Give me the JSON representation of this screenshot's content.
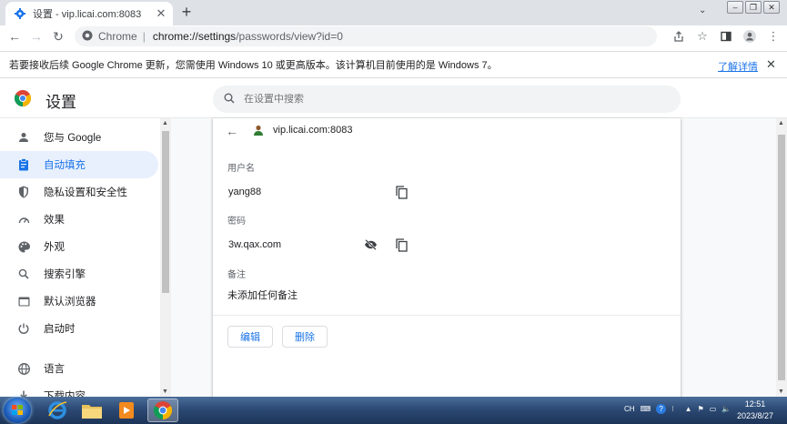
{
  "browser": {
    "tab_title": "设置 - vip.licai.com:8083",
    "new_tab_symbol": "+",
    "site_label": "Chrome",
    "url_scheme": "chrome://",
    "url_host": "settings",
    "url_path": "/passwords/view?id=0"
  },
  "infobar": {
    "message": "若要接收后续 Google Chrome 更新，您需使用 Windows 10 或更高版本。该计算机目前使用的是 Windows 7。",
    "learn_more": "了解详情"
  },
  "settings": {
    "title": "设置",
    "search_placeholder": "在设置中搜索"
  },
  "sidebar": {
    "items": [
      {
        "label": "您与 Google",
        "icon": "person-icon"
      },
      {
        "label": "自动填充",
        "icon": "clipboard-icon",
        "active": true
      },
      {
        "label": "隐私设置和安全性",
        "icon": "shield-icon"
      },
      {
        "label": "效果",
        "icon": "speedometer-icon"
      },
      {
        "label": "外观",
        "icon": "palette-icon"
      },
      {
        "label": "搜索引擎",
        "icon": "search-icon"
      },
      {
        "label": "默认浏览器",
        "icon": "browser-icon"
      },
      {
        "label": "启动时",
        "icon": "power-icon"
      },
      {
        "label": "语言",
        "icon": "globe-icon"
      },
      {
        "label": "下载内容",
        "icon": "download-icon"
      }
    ]
  },
  "password_view": {
    "site": "vip.licai.com:8083",
    "username_label": "用户名",
    "username": "yang88",
    "password_label": "密码",
    "password": "3w.qax.com",
    "note_label": "备注",
    "note": "未添加任何备注",
    "edit_label": "编辑",
    "delete_label": "删除"
  },
  "taskbar": {
    "lang": "CH",
    "time": "12:51",
    "date": "2023/8/27"
  },
  "colors": {
    "accent": "#1a73e8",
    "active_bg": "#e8f0fe"
  }
}
